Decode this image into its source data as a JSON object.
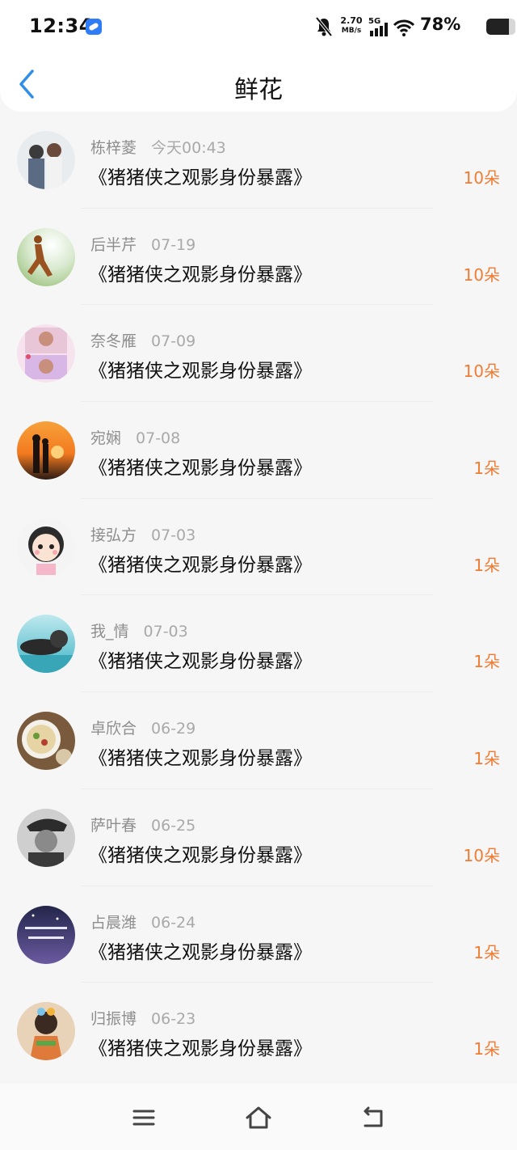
{
  "status_bar": {
    "time": "12:34",
    "net_speed_value": "2.70",
    "net_speed_unit": "MB/s",
    "network_type": "5G",
    "battery": "78%",
    "battery_level": 0.78
  },
  "header": {
    "title": "鲜花",
    "back_icon": "chevron-left-icon"
  },
  "accent_colors": {
    "back": "#2f8ee8",
    "count": "#f07c34"
  },
  "list": [
    {
      "user": "栋梓菱",
      "time": "今天00:43",
      "title": "《猪猪侠之观影身份暴露》",
      "count": "10朵"
    },
    {
      "user": "后半芹",
      "time": "07-19",
      "title": "《猪猪侠之观影身份暴露》",
      "count": "10朵"
    },
    {
      "user": "奈冬雁",
      "time": "07-09",
      "title": "《猪猪侠之观影身份暴露》",
      "count": "10朵"
    },
    {
      "user": "宛娴",
      "time": "07-08",
      "title": "《猪猪侠之观影身份暴露》",
      "count": "1朵"
    },
    {
      "user": "接弘方",
      "time": "07-03",
      "title": "《猪猪侠之观影身份暴露》",
      "count": "1朵"
    },
    {
      "user": "我_情",
      "time": "07-03",
      "title": "《猪猪侠之观影身份暴露》",
      "count": "1朵"
    },
    {
      "user": "卓欣合",
      "time": "06-29",
      "title": "《猪猪侠之观影身份暴露》",
      "count": "1朵"
    },
    {
      "user": "萨叶春",
      "time": "06-25",
      "title": "《猪猪侠之观影身份暴露》",
      "count": "10朵"
    },
    {
      "user": "占晨潍",
      "time": "06-24",
      "title": "《猪猪侠之观影身份暴露》",
      "count": "1朵"
    },
    {
      "user": "归振博",
      "time": "06-23",
      "title": "《猪猪侠之观影身份暴露》",
      "count": "1朵"
    }
  ],
  "bottom_nav": {
    "menu_icon": "menu-icon",
    "home_icon": "home-icon",
    "back_icon": "back-icon"
  }
}
